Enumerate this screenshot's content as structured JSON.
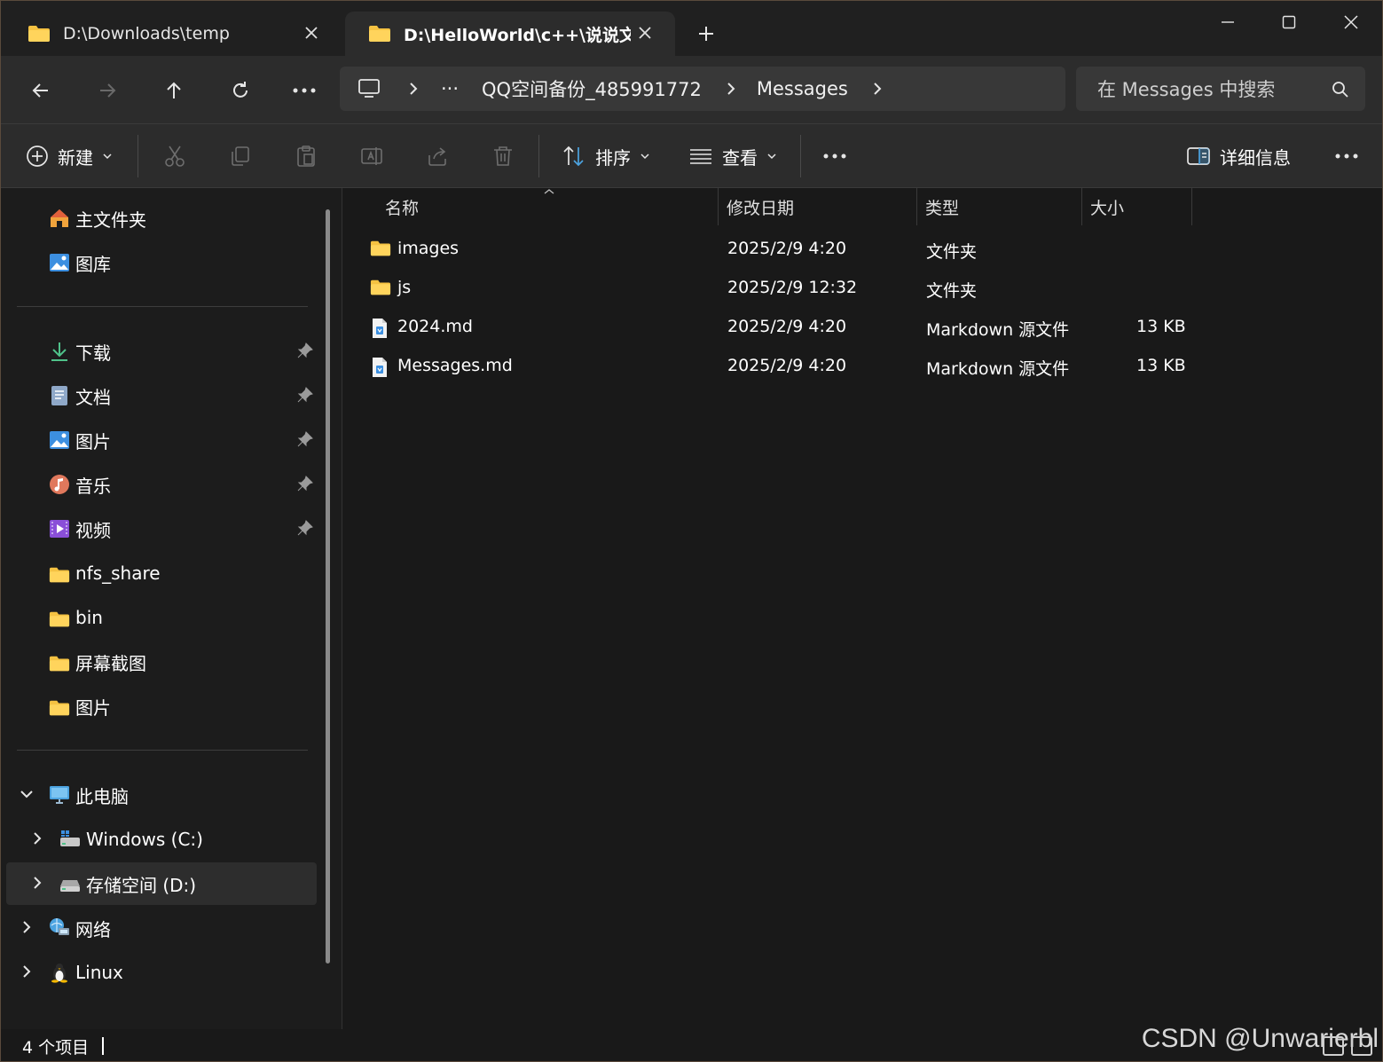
{
  "tabs": [
    {
      "label": "D:\\Downloads\\temp",
      "active": false
    },
    {
      "label": "D:\\HelloWorld\\c++\\说说文件",
      "active": true
    }
  ],
  "breadcrumb": {
    "overflow": "···",
    "segments": [
      "QQ空间备份_485991772",
      "Messages"
    ]
  },
  "search": {
    "placeholder": "在 Messages 中搜索"
  },
  "commandbar": {
    "new_label": "新建",
    "sort_label": "排序",
    "view_label": "查看",
    "details_label": "详细信息"
  },
  "sidebar": {
    "top": [
      {
        "label": "主文件夹",
        "icon": "home-icon"
      },
      {
        "label": "图库",
        "icon": "gallery-icon"
      }
    ],
    "pinned": [
      {
        "label": "下载",
        "icon": "download-icon",
        "pinned": true
      },
      {
        "label": "文档",
        "icon": "document-icon",
        "pinned": true
      },
      {
        "label": "图片",
        "icon": "pictures-icon",
        "pinned": true
      },
      {
        "label": "音乐",
        "icon": "music-icon",
        "pinned": true
      },
      {
        "label": "视频",
        "icon": "video-icon",
        "pinned": true
      },
      {
        "label": "nfs_share",
        "icon": "folder-icon"
      },
      {
        "label": "bin",
        "icon": "folder-icon"
      },
      {
        "label": "屏幕截图",
        "icon": "folder-icon"
      },
      {
        "label": "图片",
        "icon": "folder-icon"
      }
    ],
    "tree": [
      {
        "label": "此电脑",
        "icon": "computer-icon",
        "expanded": true
      },
      {
        "label": "Windows (C:)",
        "icon": "windows-drive-icon"
      },
      {
        "label": "存储空间 (D:)",
        "icon": "drive-icon",
        "selected": true
      },
      {
        "label": "网络",
        "icon": "network-icon"
      },
      {
        "label": "Linux",
        "icon": "linux-icon"
      }
    ]
  },
  "columns": [
    "名称",
    "修改日期",
    "类型",
    "大小"
  ],
  "files": [
    {
      "name": "images",
      "date": "2025/2/9 4:20",
      "type": "文件夹",
      "size": "",
      "kind": "folder"
    },
    {
      "name": "js",
      "date": "2025/2/9 12:32",
      "type": "文件夹",
      "size": "",
      "kind": "folder"
    },
    {
      "name": "2024.md",
      "date": "2025/2/9 4:20",
      "type": "Markdown 源文件",
      "size": "13 KB",
      "kind": "markdown"
    },
    {
      "name": "Messages.md",
      "date": "2025/2/9 4:20",
      "type": "Markdown 源文件",
      "size": "13 KB",
      "kind": "markdown"
    }
  ],
  "status": {
    "item_count": "4 个项目"
  },
  "watermark": "CSDN @Unwarierbl",
  "colors": {
    "folder": "#f5c242",
    "accent": "#4ca3e0",
    "background": "#191919"
  }
}
